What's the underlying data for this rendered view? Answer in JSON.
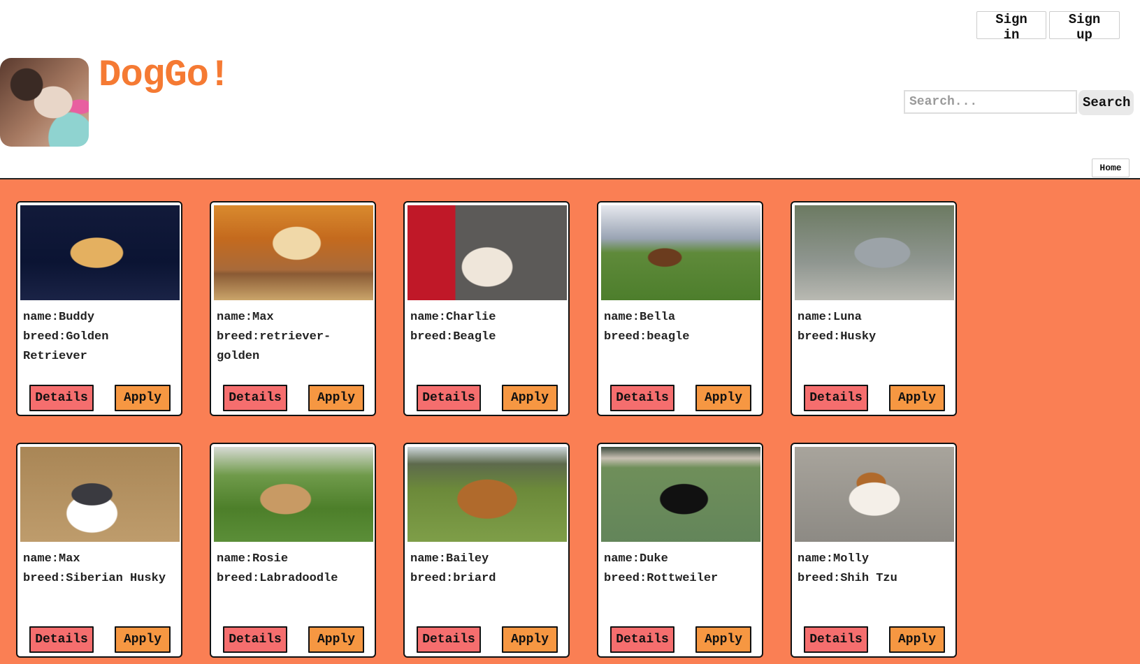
{
  "header": {
    "brand": "DogGo!",
    "sign_in": "Sign in",
    "sign_up": "Sign up",
    "search_placeholder": "Search...",
    "search_button": "Search",
    "home": "Home"
  },
  "labels": {
    "details": "Details",
    "apply": "Apply"
  },
  "dogs": [
    {
      "name": "name:Buddy",
      "breed": "breed:Golden Retriever",
      "photo": "golden-retriever-puppy"
    },
    {
      "name": "name:Max",
      "breed": "breed:retriever-golden",
      "photo": "golden-retriever-autumn"
    },
    {
      "name": "name:Charlie",
      "breed": "breed:Beagle",
      "photo": "terrier-on-cushion"
    },
    {
      "name": "name:Bella",
      "breed": "breed:beagle",
      "photo": "beagle-mountains"
    },
    {
      "name": "name:Luna",
      "breed": "breed:Husky",
      "photo": "husky-snow"
    },
    {
      "name": "name:Max",
      "breed": "breed:Siberian Husky",
      "photo": "siberian-husky"
    },
    {
      "name": "name:Rosie",
      "breed": "breed:Labradoodle",
      "photo": "labradoodle-grass"
    },
    {
      "name": "name:Bailey",
      "breed": "breed:briard",
      "photo": "briard-field"
    },
    {
      "name": "name:Duke",
      "breed": "breed:Rottweiler",
      "photo": "rottweiler-field"
    },
    {
      "name": "name:Molly",
      "breed": "breed:Shih Tzu",
      "photo": "shih-tzu"
    }
  ],
  "colors": {
    "brand": "#f57a33",
    "background": "#fa7f54",
    "details_button": "#f56e6e",
    "apply_button": "#f69742"
  }
}
